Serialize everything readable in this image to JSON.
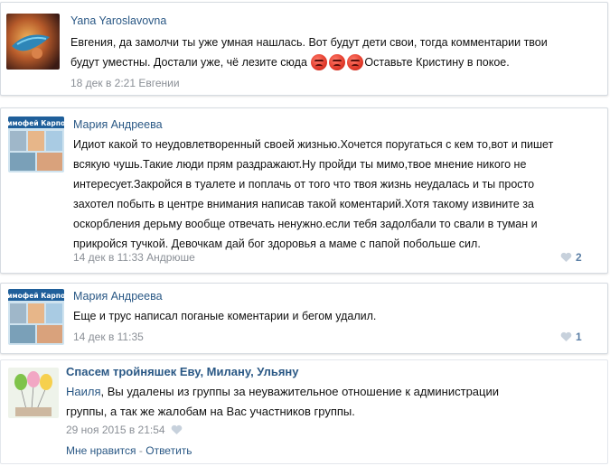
{
  "comments": [
    {
      "author": "Yana Yaroslavovna",
      "line1": "Евгения, да замолчи ты уже умная нашлась. Вот будут дети свои, тогда комментарии твои",
      "line2_before": "будут уместны. Достали уже, чё лезите сюда",
      "line2_after": "Оставьте Кристину в покое.",
      "emoji_icon": "angry-face-icon",
      "date": "18 дек в 2:21",
      "reply_to": "Евгении"
    },
    {
      "author": "Мария Андреева",
      "avatar_caption": "Тимофей Карпов",
      "lines": [
        "Идиот какой то неудовлетворенный своей жизнью.Хочется поругаться с кем то,вот и пишет",
        "всякую чушь.Такие люди прям раздражают.Ну пройди ты мимо,твое мнение никого не",
        "интересует.Закройся в туалете и поплачь от того что твоя жизнь неудалась и ты просто",
        "захотел побыть в центре внимания написав такой коментарий.Хотя такому извините за",
        "оскорбления дерьму вообще отвечать ненужно.если тебя задолбали то свали в туман и",
        "прикройся тучкой. Девочкам дай бог здоровья а маме с папой побольше сил."
      ],
      "date": "14 дек в 11:33",
      "reply_to": "Андрюше",
      "likes": "2"
    },
    {
      "author": "Мария Андреева",
      "avatar_caption": "Тимофей Карпов",
      "text": "Еще и трус написал поганые коментарии и бегом удалил.",
      "date": "14 дек в 11:35",
      "likes": "1"
    },
    {
      "group_title": "Спасем тройняшек Еву, Милану, Ульяну",
      "mention": "Наиля",
      "line1_rest": ", Вы удалены из группы за неуважительное отношение к администрации",
      "line2": "группы, а так же жалобам на Вас участников группы.",
      "date": "29 ноя 2015 в 21:54",
      "like_label": "Мне нравится",
      "separator": "-",
      "reply_label": "Ответить"
    }
  ],
  "colors": {
    "link": "#2a5885",
    "meta": "#8a8f96",
    "border": "#d6dbe1"
  }
}
